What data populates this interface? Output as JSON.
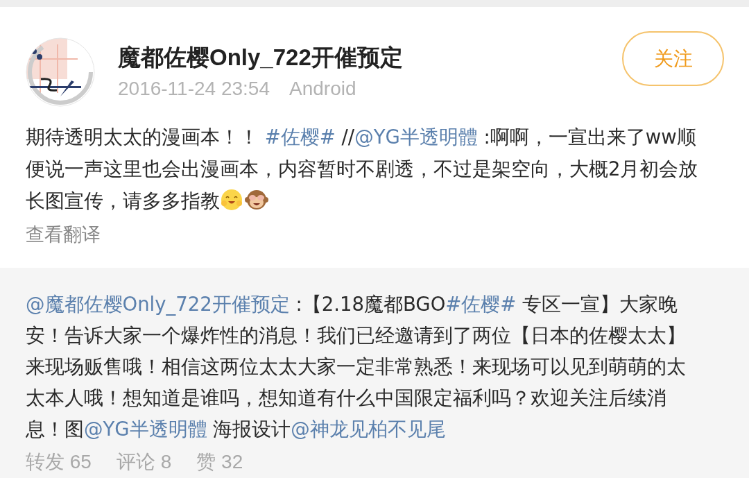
{
  "post": {
    "author": "魔都佐樱Only_722开催预定",
    "time": "2016-11-24 23:54",
    "source": "Android",
    "follow_button": "关注",
    "content": [
      {
        "kind": "text",
        "text": "期待透明太太的漫画本！！ "
      },
      {
        "kind": "topic",
        "text": "#佐樱#"
      },
      {
        "kind": "text",
        "text": " //"
      },
      {
        "kind": "mention",
        "text": "@YG半透明體"
      },
      {
        "kind": "text",
        "text": " :啊啊，一宣出来了ww顺便说一声这里也会出漫画本，内容暂时不剧透，不过是架空向，大概2月初会放长图宣传，请多多指教"
      },
      {
        "kind": "emoji-smile"
      },
      {
        "kind": "emoji-monkey"
      }
    ],
    "translate": "查看翻译"
  },
  "repost": {
    "content": [
      {
        "kind": "mention",
        "text": "@魔都佐樱Only_722开催预定"
      },
      {
        "kind": "text",
        "text": " :【2.18魔都BGO"
      },
      {
        "kind": "topic",
        "text": "#佐樱#"
      },
      {
        "kind": "text",
        "text": " 专区一宣】大家晚安！告诉大家一个爆炸性的消息！我们已经邀请到了两位【日本的佐樱太太】来现场贩售哦！相信这两位太太大家一定非常熟悉！来现场可以见到萌萌的太太本人哦！想知道是谁吗，想知道有什么中国限定福利吗？欢迎关注后续消息！图"
      },
      {
        "kind": "mention",
        "text": "@YG半透明體"
      },
      {
        "kind": "text",
        "text": " 海报设计"
      },
      {
        "kind": "mention",
        "text": "@神龙见柏不见尾"
      }
    ],
    "stats": [
      "转发 65",
      "评论 8",
      "赞 32"
    ]
  }
}
